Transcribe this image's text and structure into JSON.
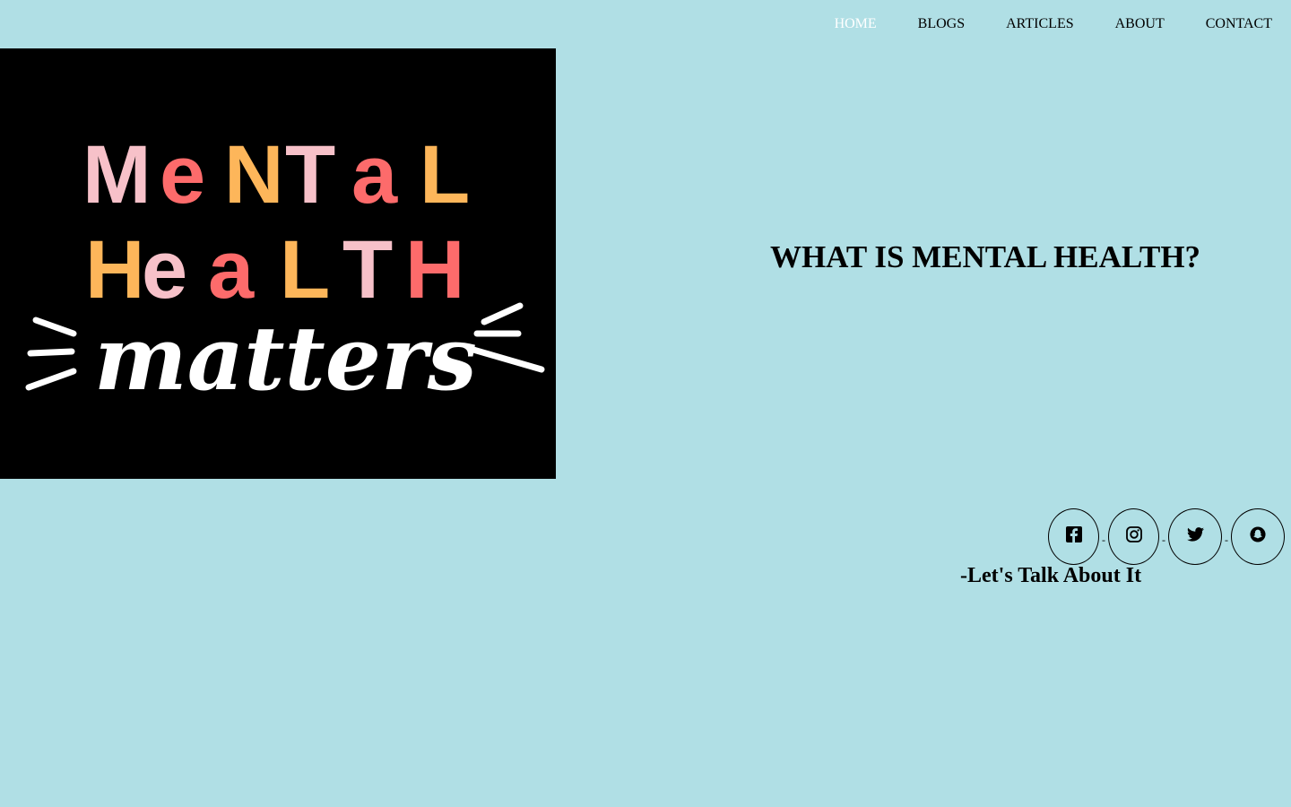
{
  "nav": {
    "items": [
      {
        "label": "HOME",
        "active": true
      },
      {
        "label": "BLOGS",
        "active": false
      },
      {
        "label": "ARTICLES",
        "active": false
      },
      {
        "label": "ABOUT",
        "active": false
      },
      {
        "label": "CONTACT",
        "active": false
      }
    ]
  },
  "hero": {
    "image_text": {
      "line1": "MeNTaL",
      "line2": "HeaLTH",
      "line3": "matters"
    }
  },
  "main": {
    "headline": "WHAT IS MENTAL HEALTH?",
    "tagline": "-Let's Talk About It"
  },
  "social": {
    "icons": [
      "facebook-icon",
      "instagram-icon",
      "twitter-icon",
      "snapchat-icon"
    ],
    "separator": "-"
  },
  "colors": {
    "background": "#b0dfe5",
    "nav_active": "#ffffff",
    "hero_bg": "#000000",
    "pink": "#f7c1c9",
    "coral": "#fd6b6b",
    "orange": "#fdb65a",
    "white": "#ffffff"
  }
}
